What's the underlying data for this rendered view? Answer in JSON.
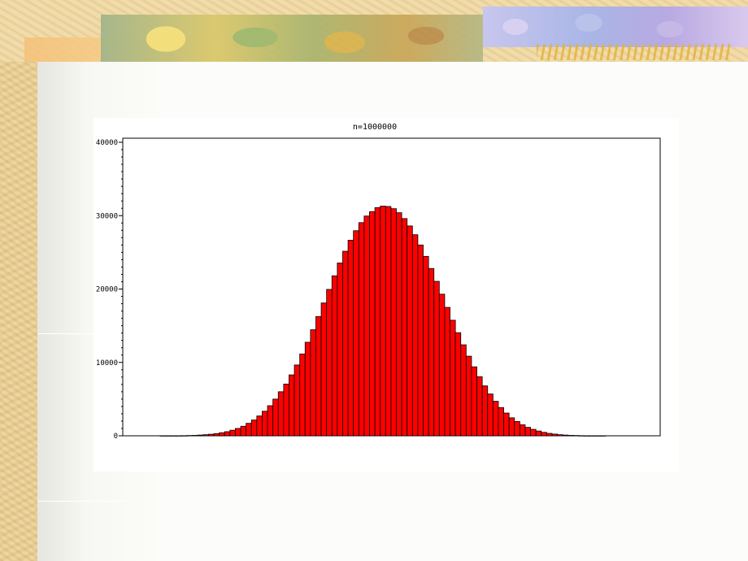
{
  "colors": {
    "bar_fill": "#ff0000",
    "bar_stroke": "#000000"
  },
  "chart_data": {
    "type": "bar",
    "title": "n=1000000",
    "xlabel": "",
    "ylabel": "",
    "ylim": [
      0,
      40000
    ],
    "yticks": [
      0,
      10000,
      20000,
      30000,
      40000
    ],
    "ytick_labels": [
      "0",
      "10000",
      "20000",
      "30000",
      "40000"
    ],
    "grid": false,
    "values": [
      10,
      10,
      10,
      10,
      20,
      40,
      60,
      100,
      150,
      210,
      300,
      420,
      560,
      760,
      1000,
      1300,
      1700,
      2150,
      2700,
      3350,
      4100,
      5000,
      6000,
      7050,
      8300,
      9650,
      11150,
      12750,
      14450,
      16250,
      18100,
      19950,
      21800,
      23550,
      25150,
      26650,
      27950,
      29050,
      29950,
      30550,
      31100,
      31300,
      31250,
      30950,
      30400,
      29600,
      28600,
      27400,
      26000,
      24450,
      22800,
      21050,
      19300,
      17500,
      15750,
      14050,
      12400,
      10850,
      9400,
      8050,
      6800,
      5700,
      4700,
      3850,
      3100,
      2450,
      1950,
      1500,
      1150,
      880,
      650,
      470,
      330,
      230,
      150,
      100,
      60,
      40,
      20,
      10,
      10,
      10,
      10
    ]
  }
}
